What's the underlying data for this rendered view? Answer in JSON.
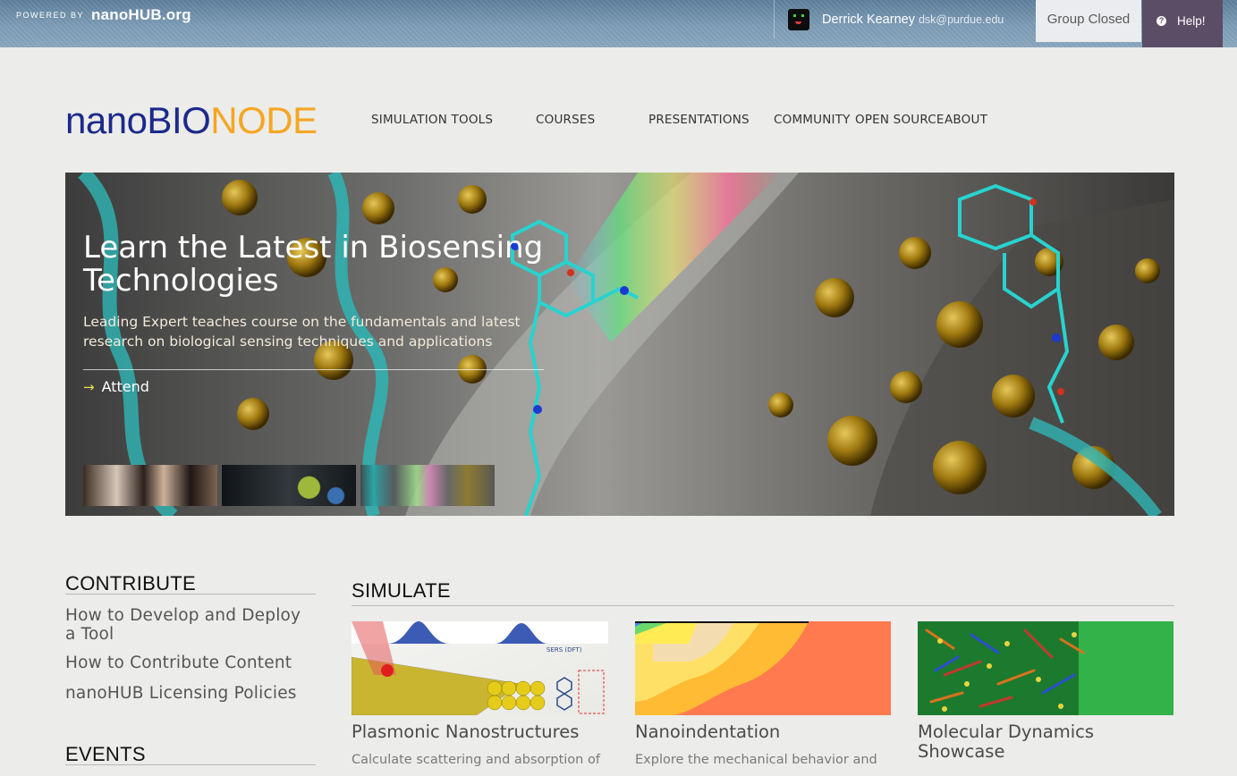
{
  "topbar": {
    "powered_by": "POWERED BY",
    "brand": "nanoHUB.org",
    "user_name": "Derrick Kearney",
    "user_email": "dsk@purdue.edu",
    "group_status": "Group Closed",
    "help_label": "Help!"
  },
  "header": {
    "logo_part1": "nanoBIO",
    "logo_part2": "NODE",
    "nav": [
      "SIMULATION TOOLS",
      "COURSES",
      "PRESENTATIONS",
      "COMMUNITY",
      "OPEN SOURCE",
      "ABOUT"
    ]
  },
  "hero": {
    "title": "Learn the Latest in Biosensing Technologies",
    "subtitle": "Leading Expert teaches course on the fundamentals and latest research on biological sensing techniques and applications",
    "cta": "Attend"
  },
  "contribute": {
    "title": "CONTRIBUTE",
    "links": [
      "How to Develop and Deploy a Tool",
      "How to Contribute Content",
      "nanoHUB Licensing Policies"
    ]
  },
  "events": {
    "title": "EVENTS"
  },
  "simulate": {
    "title": "SIMULATE",
    "cards": [
      {
        "title": "Plasmonic Nanostructures",
        "description": "Calculate scattering and absorption of",
        "image_label": "SERS (DFT)"
      },
      {
        "title": "Nanoindentation",
        "description": "Explore the mechanical behavior and"
      },
      {
        "title": "Molecular Dynamics Showcase",
        "description": ""
      }
    ]
  },
  "colors": {
    "logo_blue": "#1b2a8a",
    "logo_orange": "#f5a623",
    "help_purple": "#5b4d66",
    "page_bg": "#ececea"
  }
}
